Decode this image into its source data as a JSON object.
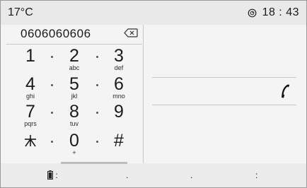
{
  "status": {
    "temperature": "17°C",
    "time": "18 : 43"
  },
  "dialer": {
    "number": "0606060606",
    "keys": [
      {
        "digit": "1",
        "letters": ""
      },
      {
        "digit": "2",
        "letters": "abc"
      },
      {
        "digit": "3",
        "letters": "def"
      },
      {
        "digit": "4",
        "letters": "ghi"
      },
      {
        "digit": "5",
        "letters": "jkl"
      },
      {
        "digit": "6",
        "letters": "mno"
      },
      {
        "digit": "7",
        "letters": "pqrs"
      },
      {
        "digit": "8",
        "letters": "tuv"
      },
      {
        "digit": "9",
        "letters": ""
      },
      {
        "digit": "*",
        "letters": ""
      },
      {
        "digit": "0",
        "letters": "+"
      },
      {
        "digit": "#",
        "letters": ""
      }
    ]
  },
  "bottom_bar": {
    "battery_dots": ":",
    "item2": ".",
    "item3": ".",
    "item4": ":"
  },
  "icons": {
    "clock": "clock-icon",
    "backspace": "backspace-icon",
    "call": "phone-handset-icon",
    "battery": "battery-icon"
  }
}
